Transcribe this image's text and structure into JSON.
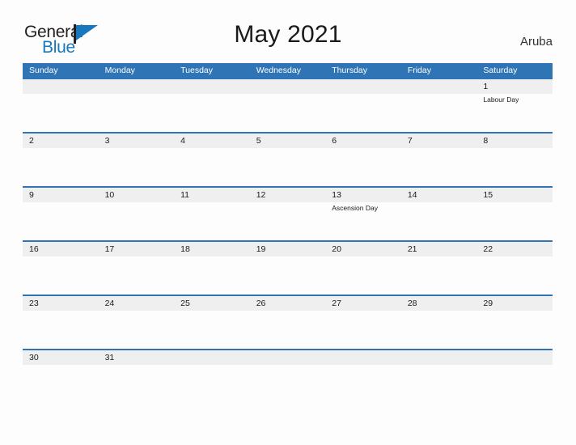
{
  "brand": {
    "name_part1": "General",
    "name_part2": "Blue",
    "logo_icon": "blue-flag-triangle-icon",
    "color_dark": "#231f20",
    "color_blue": "#1878be"
  },
  "header": {
    "title": "May 2021",
    "locale": "Aruba"
  },
  "theme": {
    "header_blue": "#2f75b5",
    "row_band_gray": "#efefef",
    "page_background": "#fdfdfd",
    "text_dark": "#1a1a1a"
  },
  "calendar": {
    "month": "May",
    "year": "2021",
    "weekday_headers": [
      "Sunday",
      "Monday",
      "Tuesday",
      "Wednesday",
      "Thursday",
      "Friday",
      "Saturday"
    ],
    "weeks": [
      [
        {
          "date": "",
          "event": ""
        },
        {
          "date": "",
          "event": ""
        },
        {
          "date": "",
          "event": ""
        },
        {
          "date": "",
          "event": ""
        },
        {
          "date": "",
          "event": ""
        },
        {
          "date": "",
          "event": ""
        },
        {
          "date": "1",
          "event": "Labour Day"
        }
      ],
      [
        {
          "date": "2",
          "event": ""
        },
        {
          "date": "3",
          "event": ""
        },
        {
          "date": "4",
          "event": ""
        },
        {
          "date": "5",
          "event": ""
        },
        {
          "date": "6",
          "event": ""
        },
        {
          "date": "7",
          "event": ""
        },
        {
          "date": "8",
          "event": ""
        }
      ],
      [
        {
          "date": "9",
          "event": ""
        },
        {
          "date": "10",
          "event": ""
        },
        {
          "date": "11",
          "event": ""
        },
        {
          "date": "12",
          "event": ""
        },
        {
          "date": "13",
          "event": "Ascension Day"
        },
        {
          "date": "14",
          "event": ""
        },
        {
          "date": "15",
          "event": ""
        }
      ],
      [
        {
          "date": "16",
          "event": ""
        },
        {
          "date": "17",
          "event": ""
        },
        {
          "date": "18",
          "event": ""
        },
        {
          "date": "19",
          "event": ""
        },
        {
          "date": "20",
          "event": ""
        },
        {
          "date": "21",
          "event": ""
        },
        {
          "date": "22",
          "event": ""
        }
      ],
      [
        {
          "date": "23",
          "event": ""
        },
        {
          "date": "24",
          "event": ""
        },
        {
          "date": "25",
          "event": ""
        },
        {
          "date": "26",
          "event": ""
        },
        {
          "date": "27",
          "event": ""
        },
        {
          "date": "28",
          "event": ""
        },
        {
          "date": "29",
          "event": ""
        }
      ],
      [
        {
          "date": "30",
          "event": ""
        },
        {
          "date": "31",
          "event": ""
        },
        {
          "date": "",
          "event": ""
        },
        {
          "date": "",
          "event": ""
        },
        {
          "date": "",
          "event": ""
        },
        {
          "date": "",
          "event": ""
        },
        {
          "date": "",
          "event": ""
        }
      ]
    ],
    "holidays": [
      {
        "date": "1",
        "name": "Labour Day"
      },
      {
        "date": "13",
        "name": "Ascension Day"
      }
    ]
  }
}
